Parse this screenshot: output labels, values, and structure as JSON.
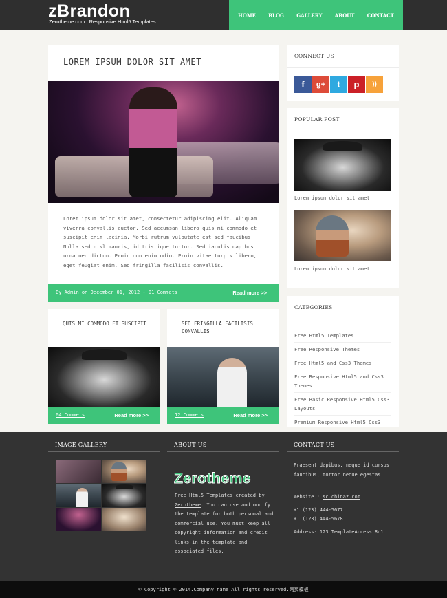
{
  "header": {
    "site_title": "zBrandon",
    "tagline": "Zerotheme.com | Responsive Html5 Templates",
    "nav": [
      "HOME",
      "BLOG",
      "GALLERY",
      "ABOUT",
      "CONTACT"
    ]
  },
  "main_post": {
    "title": "LOREM IPSUM DOLOR SIT AMET",
    "body": "Lorem ipsum dolor sit amet, consectetur adipiscing elit. Aliquam viverra convallis auctor. Sed accumsan libero quis mi commodo et suscipit enim lacinia. Morbi rutrum vulputate est sed faucibus. Nulla sed nisl mauris, id tristique tortor. Sed iaculis dapibus urna nec dictum. Proin non enim odio. Proin vitae turpis libero, eget feugiat enim. Sed fringilla facilisis convallis.",
    "meta_prefix": "By Admin on December 01, 2012 - ",
    "comments": "01 Commets",
    "read_more": "Read more >>"
  },
  "cards": [
    {
      "title": "QUIS MI COMMODO ET SUSCIPIT",
      "comments": "04 Commets",
      "read_more": "Read more >>"
    },
    {
      "title": "SED FRINGILLA FACILISIS CONVALLIS",
      "comments": "12 Commets",
      "read_more": "Read more >>"
    }
  ],
  "sidebar": {
    "connect": {
      "title": "CONNECT US",
      "icons": [
        {
          "name": "facebook-icon",
          "glyph": "f",
          "color": "#3b5998"
        },
        {
          "name": "google-plus-icon",
          "glyph": "g+",
          "color": "#dd4b39"
        },
        {
          "name": "twitter-icon",
          "glyph": "t",
          "color": "#2fa9e0"
        },
        {
          "name": "pinterest-icon",
          "glyph": "p",
          "color": "#cb2027"
        },
        {
          "name": "rss-icon",
          "glyph": "))",
          "color": "#f7a23a"
        }
      ]
    },
    "popular": {
      "title": "POPULAR POST",
      "items": [
        "Lorem ipsum dolor sit amet",
        "Lorem ipsum dolor sit amet"
      ]
    },
    "categories": {
      "title": "CATEGORIES",
      "items": [
        "Free Html5 Templates",
        "Free Responsive Themes",
        "Free Html5 and Css3 Themes",
        "Free Responsive Html5 and Css3 Themes",
        "Free Basic Responsive Html5 Css3 Layouts",
        "Premium Responsive Html5 Css3"
      ]
    }
  },
  "footer": {
    "gallery_title": "IMAGE GALLERY",
    "about_title": "ABOUT US",
    "about_logo": "Zerotheme",
    "about_link1": "Free Html5 Templates",
    "about_mid": " created by ",
    "about_link2": "Zerotheme",
    "about_rest": ". You can use and modify the template for both personal and commercial use. You must keep all copyright information and credit links in the template and associated files.",
    "contact_title": "CONTACT US",
    "contact_text": "Praesent dapibus, neque id cursus faucibus, tortor neque egestas.",
    "website_label": "Website : ",
    "website": "sc.chinaz.com",
    "phone1": "+1 (123) 444-5677",
    "phone2": "+1 (123) 444-5678",
    "address": "Address: 123 TemplateAccess Rd1"
  },
  "copyright": {
    "text": "© Copyright © 2014.Company name All rights reserved.",
    "link": "网页模板"
  }
}
